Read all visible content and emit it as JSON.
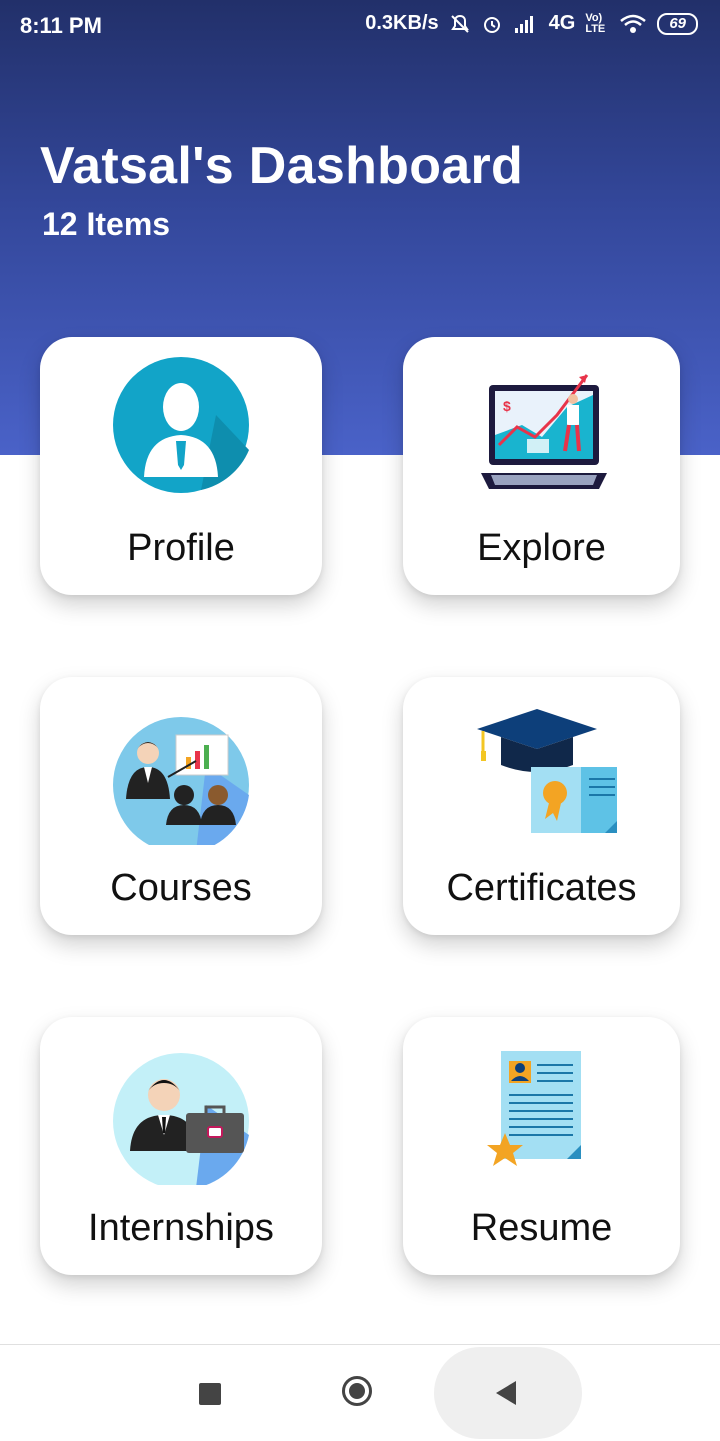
{
  "status_bar": {
    "time": "8:11 PM",
    "speed": "0.3KB/s",
    "network": "4G",
    "volte": "Vo) LTE",
    "battery": "69"
  },
  "header": {
    "title": "Vatsal's Dashboard",
    "subtitle": "12 Items",
    "gradient_top": "#22306a",
    "gradient_bottom": "#4a62c8"
  },
  "cards": [
    {
      "label": "Profile",
      "icon": "profile-icon"
    },
    {
      "label": "Explore",
      "icon": "explore-icon"
    },
    {
      "label": "Courses",
      "icon": "courses-icon"
    },
    {
      "label": "Certificates",
      "icon": "certificates-icon"
    },
    {
      "label": "Internships",
      "icon": "internships-icon"
    },
    {
      "label": "Resume",
      "icon": "resume-icon"
    }
  ],
  "nav_bar": {
    "recents": "recents-icon",
    "home": "home-icon",
    "back": "back-icon"
  }
}
